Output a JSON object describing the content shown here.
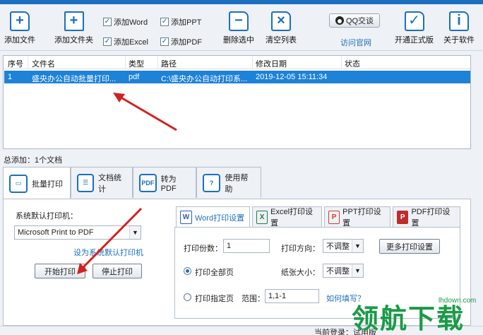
{
  "toolbar": {
    "add_file": "添加文件",
    "add_folder": "添加文件夹",
    "check_word": "添加Word",
    "check_excel": "添加Excel",
    "check_ppt": "添加PPT",
    "check_pdf": "添加PDF",
    "delete_selected": "删除选中",
    "clear_list": "清空列表",
    "qq_chat": "QQ交谈",
    "visit_site": "访问官网",
    "open_pro": "开通正式版",
    "about": "关于软件"
  },
  "table": {
    "headers": [
      "序号",
      "文件名",
      "类型",
      "路径",
      "修改日期",
      "状态"
    ],
    "rows": [
      {
        "index": "1",
        "name": "盛央办公自动批量打印...",
        "type": "pdf",
        "path": "C:\\盛央办公自动打印系...",
        "modified": "2019-12-05 15:11:34",
        "status": ""
      }
    ]
  },
  "total_label": "总添加：1个文档",
  "tabs": [
    {
      "label": "批量打印",
      "icon": "printer-icon"
    },
    {
      "label": "文档统计",
      "icon": "document-list-icon"
    },
    {
      "label": "转为PDF",
      "icon": "pdf-icon"
    },
    {
      "label": "使用帮助",
      "icon": "help-icon"
    }
  ],
  "print_panel": {
    "default_printer_label": "系统默认打印机：",
    "printer_value": "Microsoft Print to PDF",
    "set_default_link": "设为系统默认打印机",
    "start_print": "开始打印",
    "stop_print": "停止打印"
  },
  "settings_tabs": [
    {
      "label": "Word打印设置",
      "letter": "W",
      "color": "#2b5fb4"
    },
    {
      "label": "Excel打印设置",
      "letter": "X",
      "color": "#1e7d3f"
    },
    {
      "label": "PPT打印设置",
      "letter": "P",
      "color": "#c9432b"
    },
    {
      "label": "PDF打印设置",
      "letter": "P",
      "color": "#c02b2b"
    }
  ],
  "settings": {
    "copies_label": "打印份数：",
    "copies_value": "1",
    "direction_label": "打印方向：",
    "direction_value": "不调整",
    "more_settings": "更多打印设置",
    "print_all": "打印全部页",
    "paper_size_label": "纸张大小：",
    "paper_size_value": "不调整",
    "print_range": "打印指定页",
    "range_label": "范围：",
    "range_value": "1,1-1",
    "how_to_fill": "如何填写？"
  },
  "status_bar": {
    "login": "当前登录：试用版"
  },
  "watermark": {
    "text": "领航下载",
    "url": "lhdown.com"
  },
  "colors": {
    "accent": "#1b6fc0",
    "selection": "#1d82d8",
    "arrow": "#d42020"
  }
}
